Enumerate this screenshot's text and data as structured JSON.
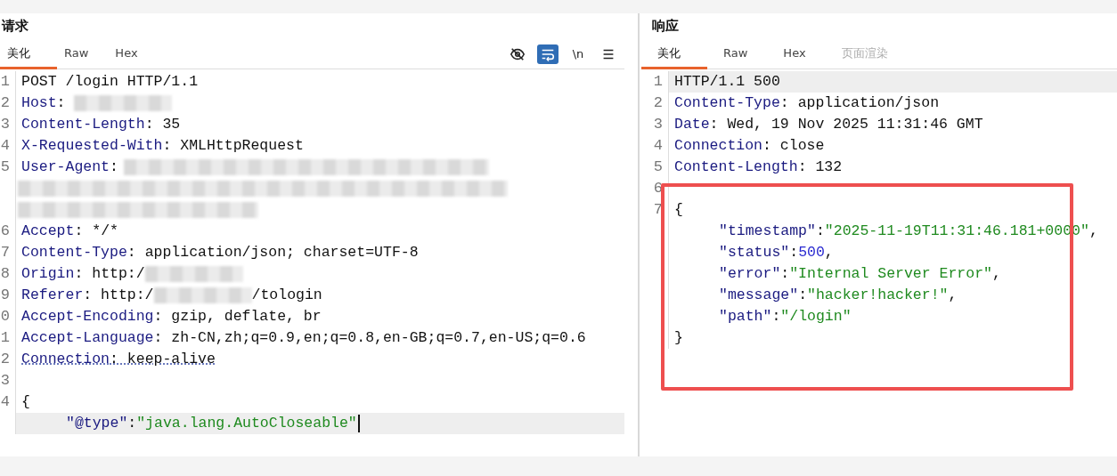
{
  "panels": [
    {
      "title": "请求",
      "tabs": [
        {
          "label": "美化",
          "selected": true,
          "disabled": false
        },
        {
          "label": "Raw",
          "selected": false,
          "disabled": false
        },
        {
          "label": "Hex",
          "selected": false,
          "disabled": false
        }
      ],
      "toolbar": [
        {
          "kind": "hide",
          "selected": false
        },
        {
          "kind": "wrap",
          "selected": true
        },
        {
          "kind": "text",
          "label": "\\n",
          "selected": false
        },
        {
          "kind": "menu",
          "selected": false
        }
      ],
      "lines": [
        {
          "number": "1",
          "tokens": [
            {
              "kind": "plain",
              "text": "POST /login HTTP/1.1"
            }
          ]
        },
        {
          "number": "2",
          "tokens": [
            {
              "kind": "key",
              "text": "Host"
            },
            {
              "kind": "plain",
              "text": ": "
            },
            {
              "kind": "redacted"
            }
          ]
        },
        {
          "number": "3",
          "tokens": [
            {
              "kind": "key",
              "text": "Content-Length"
            },
            {
              "kind": "plain",
              "text": ": 35"
            }
          ]
        },
        {
          "number": "4",
          "tokens": [
            {
              "kind": "key",
              "text": "X-Requested-With"
            },
            {
              "kind": "plain",
              "text": ": XMLHttpRequest"
            }
          ]
        },
        {
          "number": "5",
          "tokens": [
            {
              "kind": "key",
              "text": "User-Agent"
            },
            {
              "kind": "plain",
              "text": ": "
            },
            {
              "kind": "redacted"
            }
          ]
        },
        {
          "tokens": [
            {
              "kind": "redacted"
            }
          ]
        },
        {
          "tokens": [
            {
              "kind": "redacted"
            }
          ]
        },
        {
          "number": "6",
          "tokens": [
            {
              "kind": "key",
              "text": "Accept"
            },
            {
              "kind": "plain",
              "text": ": */*"
            }
          ]
        },
        {
          "number": "7",
          "tokens": [
            {
              "kind": "key",
              "text": "Content-Type"
            },
            {
              "kind": "plain",
              "text": ": application/json; charset=UTF-8"
            }
          ]
        },
        {
          "number": "8",
          "tokens": [
            {
              "kind": "key",
              "text": "Origin"
            },
            {
              "kind": "plain",
              "text": ": http:/"
            },
            {
              "kind": "redacted"
            }
          ]
        },
        {
          "number": "9",
          "tokens": [
            {
              "kind": "key",
              "text": "Referer"
            },
            {
              "kind": "plain",
              "text": ": http:/"
            },
            {
              "kind": "redacted"
            },
            {
              "kind": "plain",
              "text": "/tologin"
            }
          ]
        },
        {
          "number": "0",
          "tokens": [
            {
              "kind": "key",
              "text": "Accept-Encoding"
            },
            {
              "kind": "plain",
              "text": ": gzip, deflate, br"
            }
          ]
        },
        {
          "number": "1",
          "tokens": [
            {
              "kind": "key",
              "text": "Accept-Language"
            },
            {
              "kind": "plain",
              "text": ": zh-CN,zh;q=0.9,en;q=0.8,en-GB;q=0.7,en-US;q=0.6"
            }
          ]
        },
        {
          "number": "2",
          "squiggle": true,
          "tokens": [
            {
              "kind": "key",
              "text": "Connection"
            },
            {
              "kind": "plain",
              "text": ": keep-alive"
            }
          ]
        },
        {
          "number": "3"
        },
        {
          "number": "4",
          "tokens": [
            {
              "kind": "plain",
              "text": "{"
            }
          ]
        },
        {
          "current": true,
          "cursor": true,
          "tokens": [
            {
              "kind": "indent"
            },
            {
              "kind": "key",
              "text": "\"@type\""
            },
            {
              "kind": "plain",
              "text": ":"
            },
            {
              "kind": "string",
              "text": "\"java.lang.AutoCloseable\""
            }
          ]
        }
      ]
    },
    {
      "title": "响应",
      "tabs": [
        {
          "label": "美化",
          "selected": true,
          "disabled": false
        },
        {
          "label": "Raw",
          "selected": false,
          "disabled": false
        },
        {
          "label": "Hex",
          "selected": false,
          "disabled": false
        },
        {
          "label": "页面渲染",
          "selected": false,
          "disabled": true
        }
      ],
      "highlight_box": true,
      "lines": [
        {
          "number": "1",
          "current": true,
          "tokens": [
            {
              "kind": "plain",
              "text": "HTTP/1.1 500"
            }
          ]
        },
        {
          "number": "2",
          "tokens": [
            {
              "kind": "key",
              "text": "Content-Type"
            },
            {
              "kind": "plain",
              "text": ": application/json"
            }
          ]
        },
        {
          "number": "3",
          "tokens": [
            {
              "kind": "key",
              "text": "Date"
            },
            {
              "kind": "plain",
              "text": ": Wed, 19 Nov 2025 11:31:46 GMT"
            }
          ]
        },
        {
          "number": "4",
          "tokens": [
            {
              "kind": "key",
              "text": "Connection"
            },
            {
              "kind": "plain",
              "text": ": close"
            }
          ]
        },
        {
          "number": "5",
          "tokens": [
            {
              "kind": "key",
              "text": "Content-Length"
            },
            {
              "kind": "plain",
              "text": ": 132"
            }
          ]
        },
        {
          "number": "6"
        },
        {
          "number": "7",
          "tokens": [
            {
              "kind": "plain",
              "text": "{"
            }
          ]
        },
        {
          "tokens": [
            {
              "kind": "indent"
            },
            {
              "kind": "key",
              "text": "\"timestamp\""
            },
            {
              "kind": "plain",
              "text": ":"
            },
            {
              "kind": "string",
              "text": "\"2025-11-19T11:31:46.181+0000\""
            },
            {
              "kind": "plain",
              "text": ","
            }
          ]
        },
        {
          "tokens": [
            {
              "kind": "indent"
            },
            {
              "kind": "key",
              "text": "\"status\""
            },
            {
              "kind": "plain",
              "text": ":"
            },
            {
              "kind": "number",
              "text": "500"
            },
            {
              "kind": "plain",
              "text": ","
            }
          ]
        },
        {
          "tokens": [
            {
              "kind": "indent"
            },
            {
              "kind": "key",
              "text": "\"error\""
            },
            {
              "kind": "plain",
              "text": ":"
            },
            {
              "kind": "string",
              "text": "\"Internal Server Error\""
            },
            {
              "kind": "plain",
              "text": ","
            }
          ]
        },
        {
          "tokens": [
            {
              "kind": "indent"
            },
            {
              "kind": "key",
              "text": "\"message\""
            },
            {
              "kind": "plain",
              "text": ":"
            },
            {
              "kind": "string",
              "text": "\"hacker!hacker!\""
            },
            {
              "kind": "plain",
              "text": ","
            }
          ]
        },
        {
          "tokens": [
            {
              "kind": "indent"
            },
            {
              "kind": "key",
              "text": "\"path\""
            },
            {
              "kind": "plain",
              "text": ":"
            },
            {
              "kind": "string",
              "text": "\"/login\""
            }
          ]
        },
        {
          "tokens": [
            {
              "kind": "plain",
              "text": "}"
            }
          ]
        }
      ]
    }
  ]
}
